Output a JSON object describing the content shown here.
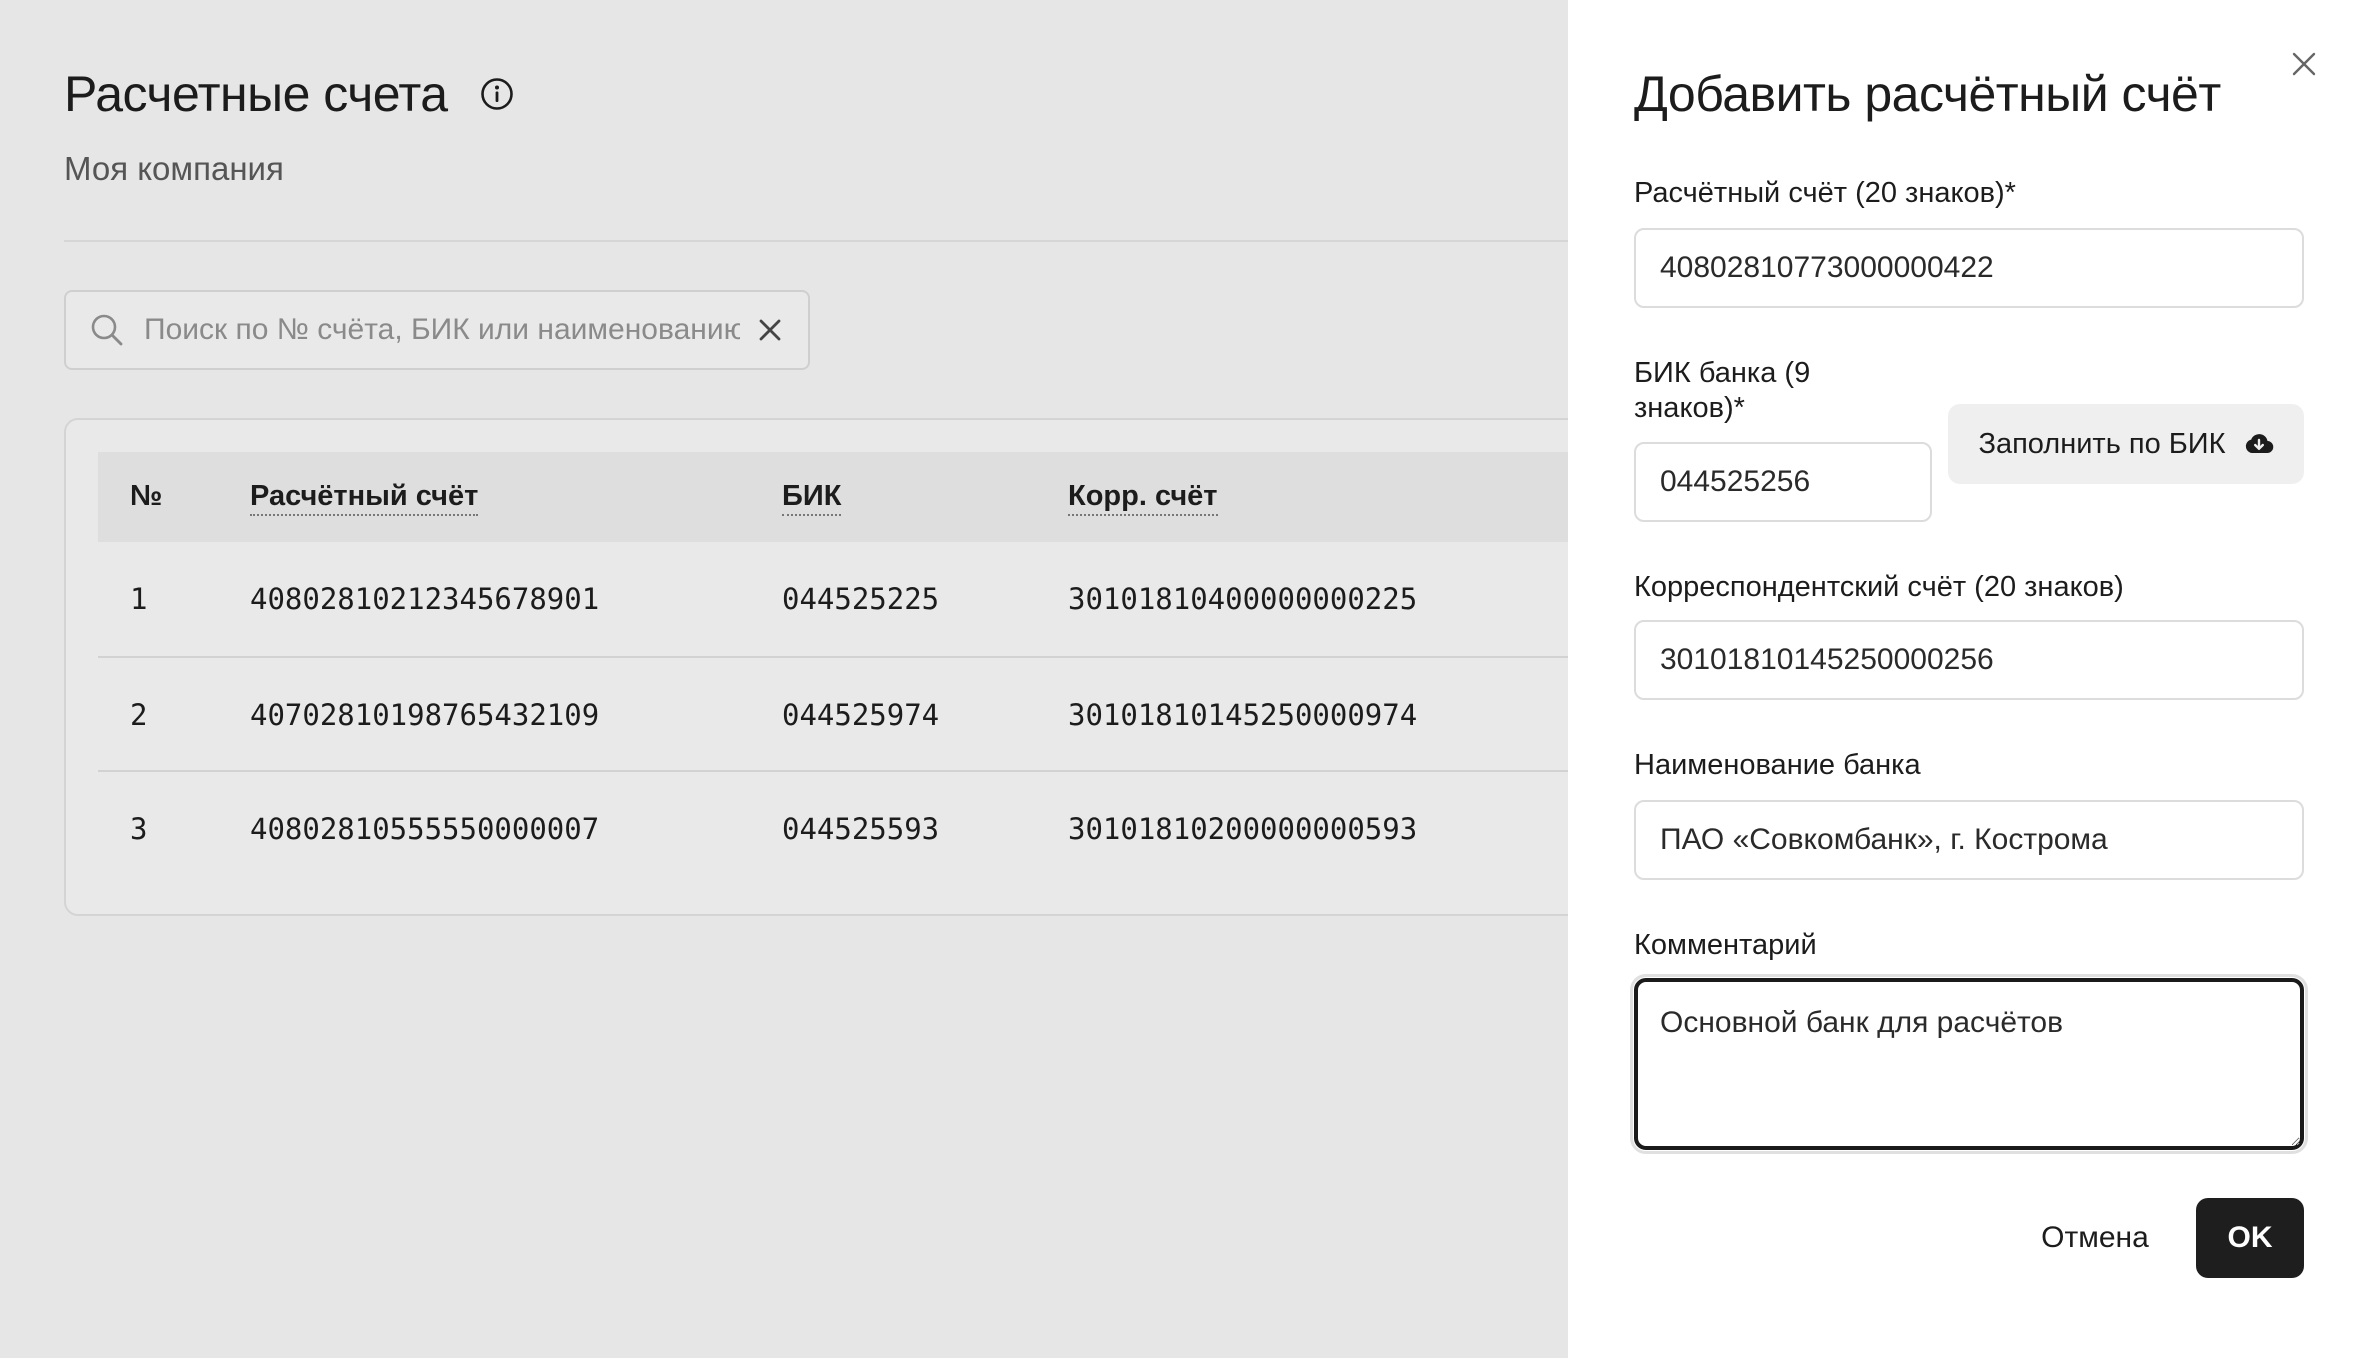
{
  "page": {
    "title": "Расчетные счета",
    "subtitle": "Моя компания",
    "search": {
      "placeholder": "Поиск по № счёта, БИК или наименованию",
      "value": ""
    },
    "table": {
      "columns": [
        "№",
        "Расчётный счёт",
        "БИК",
        "Корр. счёт"
      ],
      "rows": [
        [
          "1",
          "40802810212345678901",
          "044525225",
          "30101810400000000225"
        ],
        [
          "2",
          "40702810198765432109",
          "044525974",
          "30101810145250000974"
        ],
        [
          "3",
          "40802810555550000007",
          "044525593",
          "30101810200000000593"
        ]
      ]
    }
  },
  "drawer": {
    "title": "Добавить расчётный счёт",
    "account": {
      "label": "Расчётный счёт (20 знаков)*",
      "value": "40802810773000000422"
    },
    "bik": {
      "label": "БИК банка (9 знаков)*",
      "value": "044525256"
    },
    "fill_by_bik_label": "Заполнить по БИК",
    "corr": {
      "label": "Корреспондентский счёт (20 знаков)",
      "value": "30101810145250000256"
    },
    "bank_name": {
      "label": "Наименование банка",
      "value": "ПАО «Совкомбанк», г. Кострома"
    },
    "comment": {
      "label": "Комментарий",
      "value": "Основной банк для расчётов"
    },
    "cancel_label": "Отмена",
    "ok_label": "OK"
  },
  "icons": {
    "info": "info-icon",
    "search": "search-icon",
    "clear": "close-icon",
    "close": "close-icon",
    "cloud": "cloud-download-icon"
  }
}
